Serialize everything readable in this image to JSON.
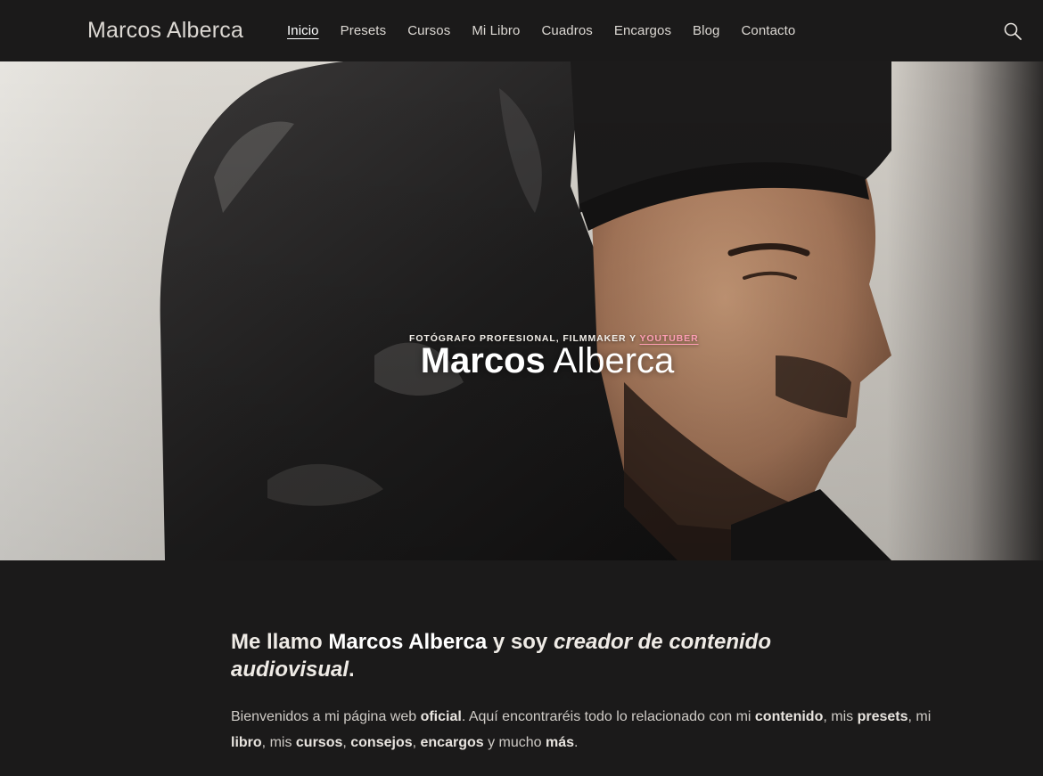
{
  "header": {
    "brand": "Marcos Alberca",
    "nav": [
      {
        "label": "Inicio",
        "active": true
      },
      {
        "label": "Presets"
      },
      {
        "label": "Cursos"
      },
      {
        "label": "Mi Libro"
      },
      {
        "label": "Cuadros"
      },
      {
        "label": "Encargos"
      },
      {
        "label": "Blog"
      },
      {
        "label": "Contacto"
      }
    ],
    "search_icon": "search-icon"
  },
  "hero": {
    "title_bold": "Marcos",
    "title_light": "Alberca",
    "subtitle_prefix": "Fotógrafo profesional, filmmaker y",
    "subtitle_link": "YouTuber"
  },
  "intro": {
    "t1": "Me llamo ",
    "b1": "Marcos Alberca",
    "t2": " y soy ",
    "i1": "creador de contenido audiovisual",
    "t3": "."
  },
  "welcome": {
    "t1": "Bienvenidos a mi página web ",
    "b1": "oficial",
    "t2": ". Aquí encontraréis todo lo relacionado con mi ",
    "b2": "contenido",
    "t3": ", mis ",
    "b3": "presets",
    "t4": ", mi ",
    "b4": "libro",
    "t5": ", mis ",
    "b5": "cursos",
    "t6": ", ",
    "b6": "consejos",
    "t7": ", ",
    "b7": "encargos",
    "t8": " y mucho ",
    "b8": "más",
    "t9": "."
  },
  "colors": {
    "background": "#1b1a1a",
    "text": "#e9e6e2",
    "accent_link": "#ff9fb5"
  }
}
